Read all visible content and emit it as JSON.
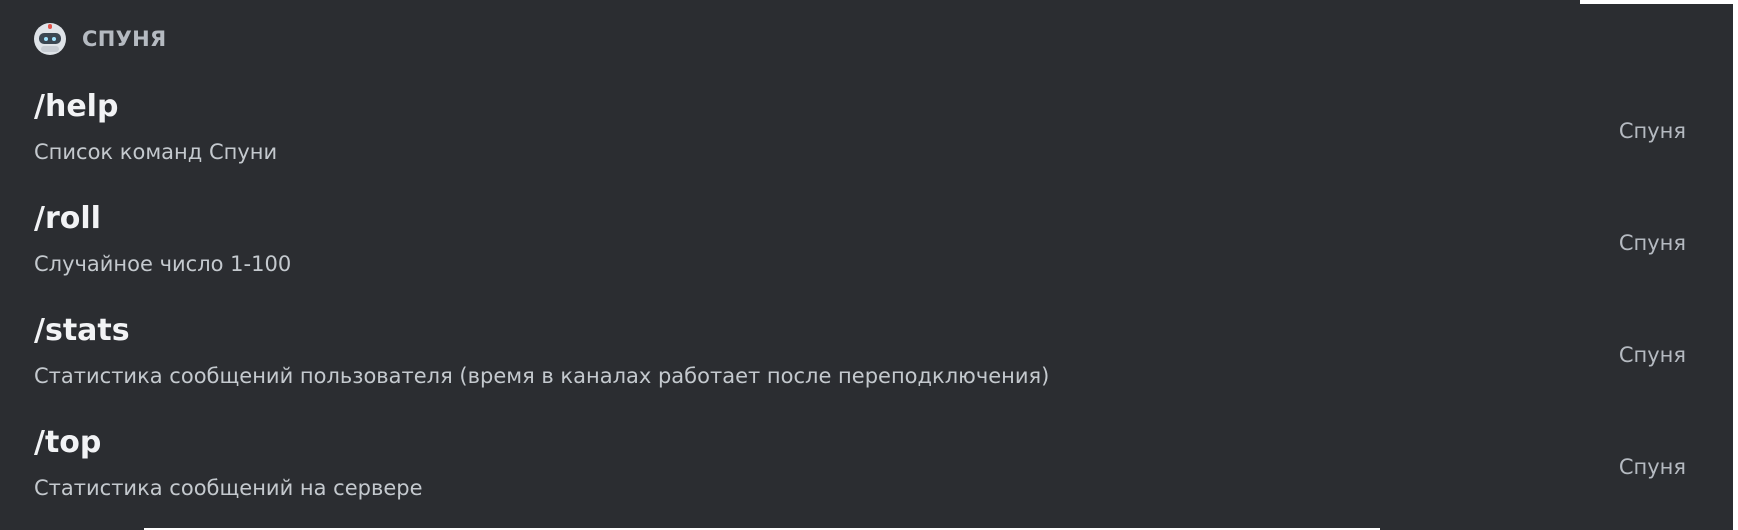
{
  "app": {
    "bot_name": "СПУНЯ",
    "bot_icon": "robot-avatar-icon"
  },
  "commands": [
    {
      "name": "/help",
      "description": "Список команд Спуни",
      "source": "Спуня"
    },
    {
      "name": "/roll",
      "description": "Случайное число 1-100",
      "source": "Спуня"
    },
    {
      "name": "/stats",
      "description": "Статистика сообщений пользователя (время в каналах работает после переподключения)",
      "source": "Спуня"
    },
    {
      "name": "/top",
      "description": "Статистика сообщений на сервере",
      "source": "Спуня"
    }
  ],
  "colors": {
    "background": "#2b2d31",
    "command_name": "#f2f3f5",
    "description": "#c4c9ce",
    "muted": "#b5bac1"
  }
}
